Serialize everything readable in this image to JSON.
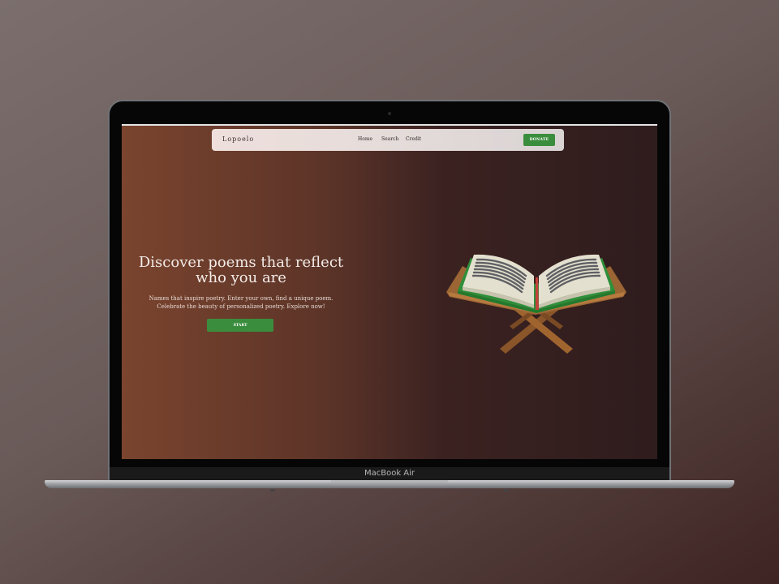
{
  "device": {
    "label": "MacBook Air"
  },
  "nav": {
    "logo": "Lopoelo",
    "links": [
      "Home",
      "Search",
      "Credit"
    ],
    "donate_label": "DONATE"
  },
  "hero": {
    "title_line1": "Discover poems that reflect",
    "title_line2": "who you are",
    "subtitle_line1": "Names that inspire poetry. Enter your own, find a unique poem.",
    "subtitle_line2": "Celebrate the beauty of personalized poetry. Explore now!",
    "start_label": "START"
  },
  "illustration": {
    "icon": "open-book-on-stand-icon"
  },
  "colors": {
    "accent": "#3b8d3e",
    "navbar": "#e5dcda",
    "hero_left": "#7a442e",
    "hero_right": "#2f1c1d"
  }
}
